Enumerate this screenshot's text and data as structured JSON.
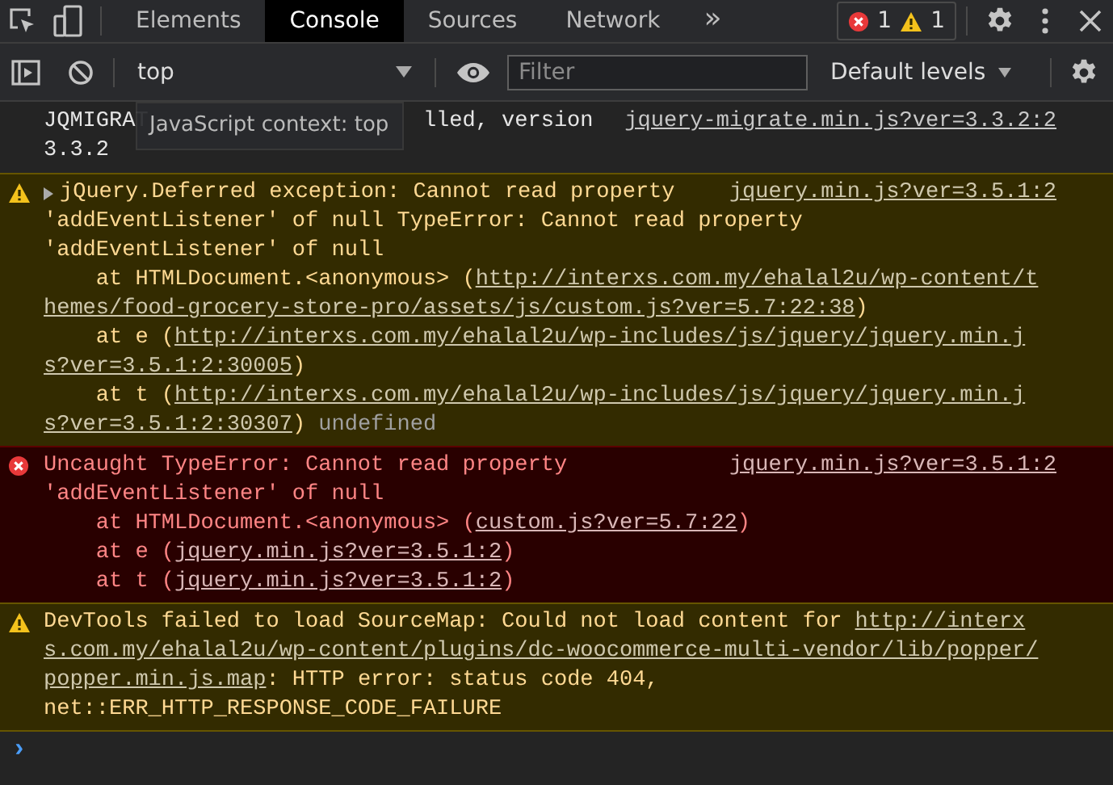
{
  "tabs": [
    {
      "label": "Elements",
      "selected": false
    },
    {
      "label": "Console",
      "selected": true
    },
    {
      "label": "Sources",
      "selected": false
    },
    {
      "label": "Network",
      "selected": false
    }
  ],
  "more_tabs": "»",
  "issues": {
    "errors": "1",
    "warnings": "1"
  },
  "console_toolbar": {
    "context": "top",
    "filter": {
      "placeholder": "Filter"
    },
    "levels": "Default levels"
  },
  "messages": [
    {
      "kind": "info",
      "source": "jquery-migrate.min.js?ver=3.3.2:2",
      "tooltip": "JavaScript context: top",
      "lines": [
        [
          {
            "kind": "text",
            "text": "JQMIGRAT"
          },
          {
            "kind": "covered"
          },
          {
            "kind": "text",
            "text": "lled, version"
          }
        ],
        [
          {
            "kind": "text",
            "text": "3.3.2"
          }
        ]
      ]
    },
    {
      "kind": "warning",
      "expanded": false,
      "source": "jquery.min.js?ver=3.5.1:2",
      "lines": [
        [
          {
            "kind": "text",
            "text": "jQuery.Deferred exception: Cannot read property"
          }
        ],
        [
          {
            "kind": "text",
            "text": "'addEventListener' of null TypeError: Cannot read property"
          }
        ],
        [
          {
            "kind": "text",
            "text": "'addEventListener' of null"
          }
        ],
        [
          {
            "kind": "text",
            "text": "    at HTMLDocument.<anonymous> ("
          },
          {
            "kind": "link",
            "text": "http://interxs.com.my/ehalal2u/wp-content/t"
          }
        ],
        [
          {
            "kind": "link",
            "text": "hemes/food-grocery-store-pro/assets/js/custom.js?ver=5.7:22:38"
          },
          {
            "kind": "text",
            "text": ")"
          }
        ],
        [
          {
            "kind": "text",
            "text": "    at e ("
          },
          {
            "kind": "link",
            "text": "http://interxs.com.my/ehalal2u/wp-includes/js/jquery/jquery.min.j"
          }
        ],
        [
          {
            "kind": "link",
            "text": "s?ver=3.5.1:2:30005"
          },
          {
            "kind": "text",
            "text": ")"
          }
        ],
        [
          {
            "kind": "text",
            "text": "    at t ("
          },
          {
            "kind": "link",
            "text": "http://interxs.com.my/ehalal2u/wp-includes/js/jquery/jquery.min.j"
          }
        ],
        [
          {
            "kind": "link",
            "text": "s?ver=3.5.1:2:30307"
          },
          {
            "kind": "text",
            "text": ")"
          },
          {
            "kind": "muted",
            "text": " undefined"
          }
        ]
      ]
    },
    {
      "kind": "error",
      "source": "jquery.min.js?ver=3.5.1:2",
      "lines": [
        [
          {
            "kind": "text",
            "text": "Uncaught TypeError: Cannot read property"
          }
        ],
        [
          {
            "kind": "text",
            "text": "'addEventListener' of null"
          }
        ],
        [
          {
            "kind": "text",
            "text": "    at HTMLDocument.<anonymous> ("
          },
          {
            "kind": "link",
            "text": "custom.js?ver=5.7:22"
          },
          {
            "kind": "text",
            "text": ")"
          }
        ],
        [
          {
            "kind": "text",
            "text": "    at e ("
          },
          {
            "kind": "link",
            "text": "jquery.min.js?ver=3.5.1:2"
          },
          {
            "kind": "text",
            "text": ")"
          }
        ],
        [
          {
            "kind": "text",
            "text": "    at t ("
          },
          {
            "kind": "link",
            "text": "jquery.min.js?ver=3.5.1:2"
          },
          {
            "kind": "text",
            "text": ")"
          }
        ]
      ]
    },
    {
      "kind": "warning",
      "lines": [
        [
          {
            "kind": "text",
            "text": "DevTools failed to load SourceMap: Could not load content for "
          },
          {
            "kind": "link",
            "text": "http://interx"
          }
        ],
        [
          {
            "kind": "link",
            "text": "s.com.my/ehalal2u/wp-content/plugins/dc-woocommerce-multi-vendor/lib/popper/"
          }
        ],
        [
          {
            "kind": "link",
            "text": "popper.min.js.map"
          },
          {
            "kind": "text",
            "text": ": HTTP error: status code 404,"
          }
        ],
        [
          {
            "kind": "text",
            "text": "net::ERR_HTTP_RESPONSE_CODE_FAILURE"
          }
        ]
      ]
    }
  ],
  "prompt": "›"
}
